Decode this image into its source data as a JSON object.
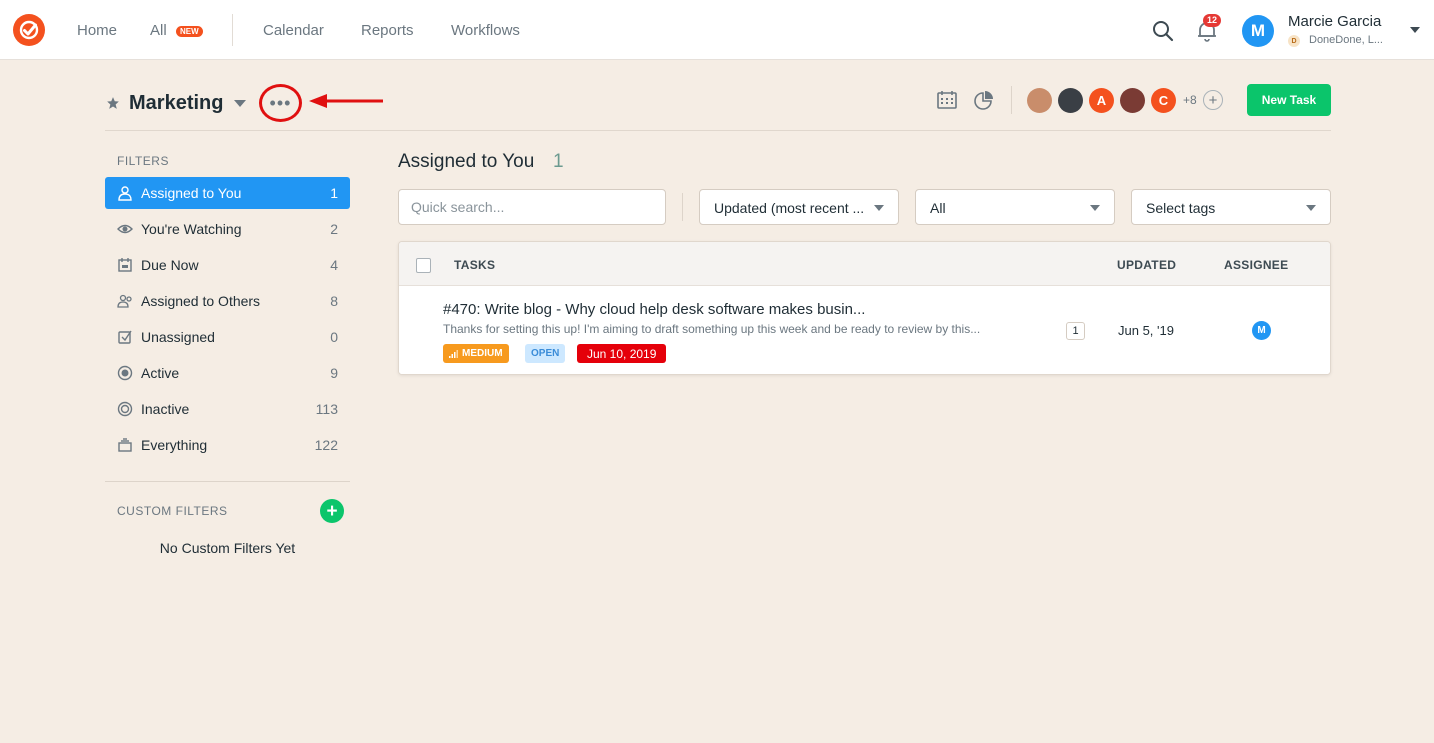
{
  "nav": {
    "home": "Home",
    "all": "All",
    "all_badge": "NEW",
    "calendar": "Calendar",
    "reports": "Reports",
    "workflows": "Workflows",
    "notification_count": "12",
    "user_initial": "M",
    "user_name": "Marcie Garcia",
    "org_initial": "D",
    "org_name": "DoneDone, L..."
  },
  "project": {
    "title": "Marketing",
    "more_label": "•••",
    "members": [
      {
        "initial": "",
        "color": "#c98d6b"
      },
      {
        "initial": "",
        "color": "#3a3f45"
      },
      {
        "initial": "A",
        "color": "#f4511e"
      },
      {
        "initial": "",
        "color": "#7a3b34"
      },
      {
        "initial": "C",
        "color": "#f4511e"
      }
    ],
    "more_members": "+8",
    "new_task_label": "New Task"
  },
  "sidebar": {
    "filters_label": "FILTERS",
    "items": [
      {
        "label": "Assigned to You",
        "count": "1",
        "icon": "user-icon",
        "active": true
      },
      {
        "label": "You're Watching",
        "count": "2",
        "icon": "eye-icon",
        "active": false
      },
      {
        "label": "Due Now",
        "count": "4",
        "icon": "calendar-due-icon",
        "active": false
      },
      {
        "label": "Assigned to Others",
        "count": "8",
        "icon": "users-icon",
        "active": false
      },
      {
        "label": "Unassigned",
        "count": "0",
        "icon": "unassigned-icon",
        "active": false
      },
      {
        "label": "Active",
        "count": "9",
        "icon": "active-icon",
        "active": false
      },
      {
        "label": "Inactive",
        "count": "113",
        "icon": "inactive-icon",
        "active": false
      },
      {
        "label": "Everything",
        "count": "122",
        "icon": "stack-icon",
        "active": false
      }
    ],
    "custom_filters_label": "CUSTOM FILTERS",
    "no_custom_filters": "No Custom Filters Yet"
  },
  "main": {
    "title": "Assigned to You",
    "count": "1",
    "search_placeholder": "Quick search...",
    "sort_value": "Updated (most recent ...",
    "status_value": "All",
    "tags_value": "Select tags",
    "columns": {
      "tasks": "TASKS",
      "updated": "UPDATED",
      "assignee": "ASSIGNEE"
    },
    "tasks": [
      {
        "title": "#470: Write blog - Why cloud help desk software makes busin...",
        "snippet": "Thanks for setting this up! I'm aiming to draft something up this week and be ready to review by this...",
        "priority": "MEDIUM",
        "status": "OPEN",
        "due": "Jun 10, 2019",
        "comments": "1",
        "updated": "Jun 5, '19",
        "assignee_initial": "M"
      }
    ]
  },
  "colors": {
    "brand": "#f4511e",
    "active_filter": "#2196f3",
    "new_task": "#0bc56b",
    "highlight_circle": "#e01010",
    "priority_medium": "#f79a1e",
    "due_overdue": "#e5000a"
  }
}
